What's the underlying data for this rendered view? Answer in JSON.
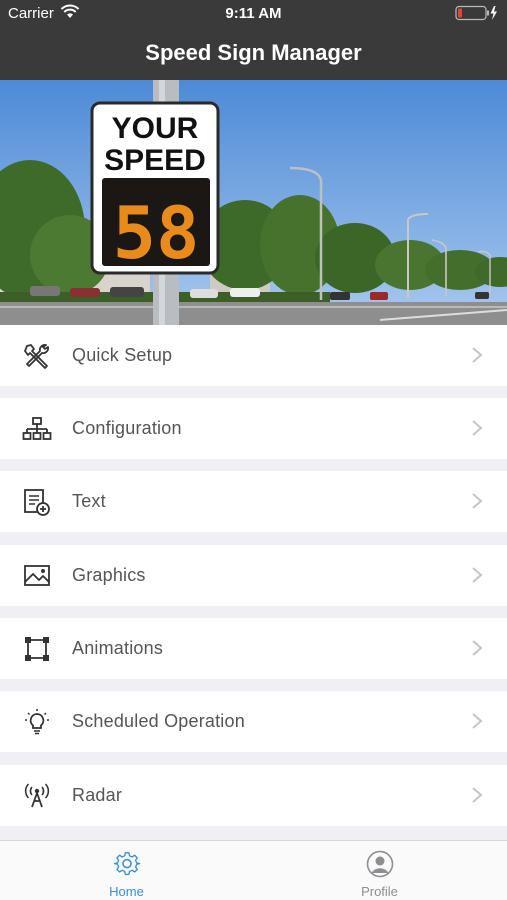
{
  "status_bar": {
    "carrier": "Carrier",
    "time": "9:11 AM",
    "battery_color": "#e24444"
  },
  "nav": {
    "title": "Speed Sign Manager"
  },
  "hero": {
    "sign_top_text": "YOUR",
    "sign_mid_text": "SPEED",
    "sign_speed": "58",
    "speed_color": "#e88a1c"
  },
  "menu": {
    "items": [
      {
        "label": "Quick Setup",
        "icon": "tools-icon"
      },
      {
        "label": "Configuration",
        "icon": "hierarchy-icon"
      },
      {
        "label": "Text",
        "icon": "text-add-icon"
      },
      {
        "label": "Graphics",
        "icon": "image-icon"
      },
      {
        "label": "Animations",
        "icon": "animation-frame-icon"
      },
      {
        "label": "Scheduled Operation",
        "icon": "lightbulb-icon"
      },
      {
        "label": "Radar",
        "icon": "radar-antenna-icon"
      }
    ]
  },
  "tabs": {
    "home": {
      "label": "Home",
      "icon": "gear-icon",
      "color": "#3b8fd6"
    },
    "profile": {
      "label": "Profile",
      "icon": "person-icon",
      "color": "#8e8e93"
    }
  }
}
